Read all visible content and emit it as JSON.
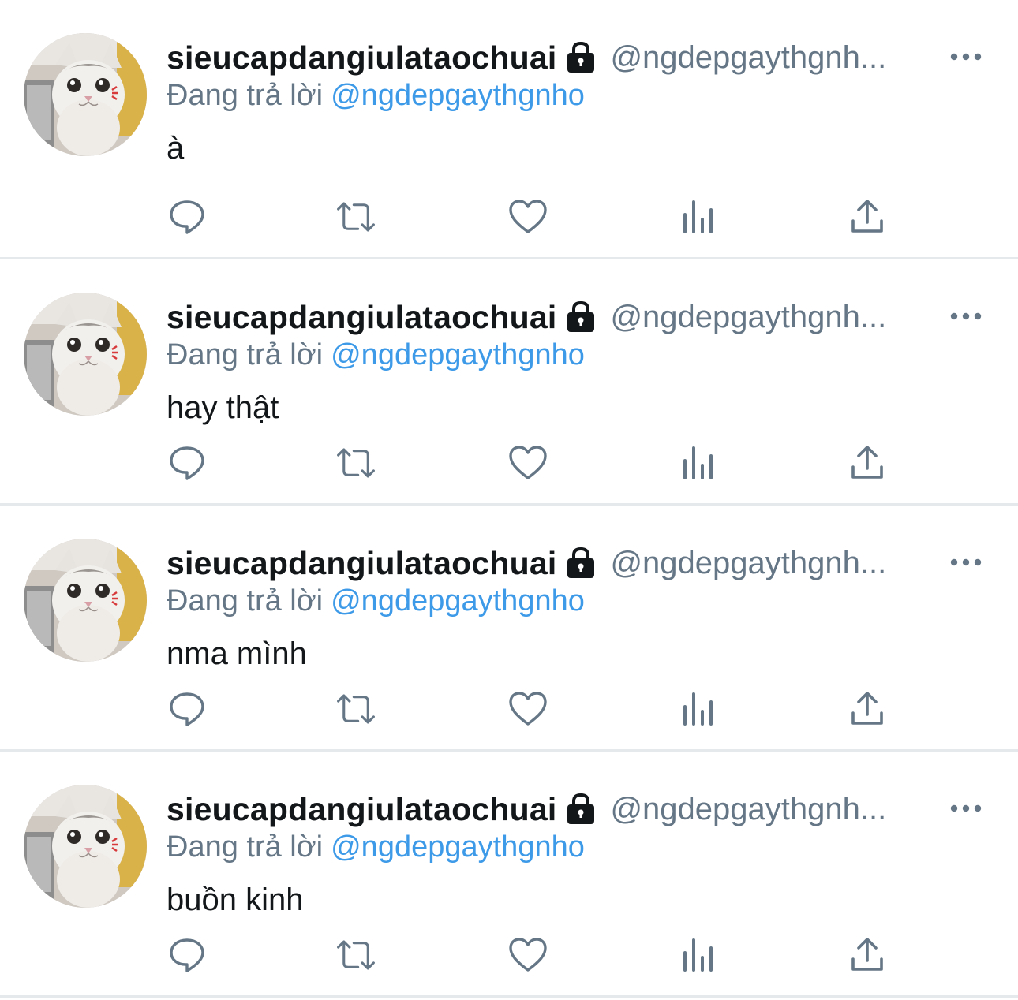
{
  "tweets": [
    {
      "display_name": "sieucapdangiulataochuai",
      "handle": "@ngdepgaythgnh...",
      "reply_prefix": "Đang trả lời",
      "reply_to": "@ngdepgaythgnho",
      "text": "à"
    },
    {
      "display_name": "sieucapdangiulataochuai",
      "handle": "@ngdepgaythgnh...",
      "reply_prefix": "Đang trả lời",
      "reply_to": "@ngdepgaythgnho",
      "text": "hay thật"
    },
    {
      "display_name": "sieucapdangiulataochuai",
      "handle": "@ngdepgaythgnh...",
      "reply_prefix": "Đang trả lời",
      "reply_to": "@ngdepgaythgnho",
      "text": "nma mình"
    },
    {
      "display_name": "sieucapdangiulataochuai",
      "handle": "@ngdepgaythgnh...",
      "reply_prefix": "Đang trả lời",
      "reply_to": "@ngdepgaythgnho",
      "text": "buồn kinh"
    }
  ],
  "icons": {
    "lock": "lock-icon",
    "more": "more-horizontal-icon",
    "reply": "reply-icon",
    "retweet": "retweet-icon",
    "like": "heart-icon",
    "analytics": "analytics-icon",
    "share": "share-icon"
  },
  "colors": {
    "text_primary": "#14171a",
    "text_secondary": "#657786",
    "mention": "#3d9ae8",
    "divider": "#e6e9eb"
  }
}
